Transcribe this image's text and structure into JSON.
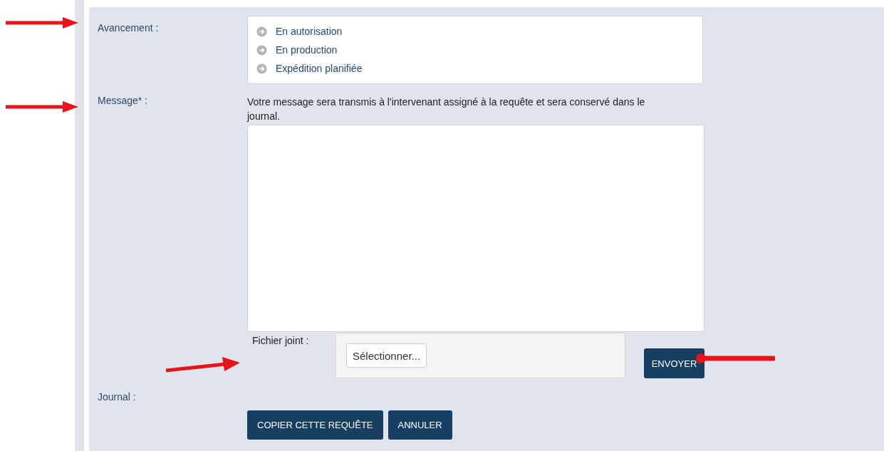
{
  "avancement": {
    "label": "Avancement :",
    "items": [
      {
        "label": "En autorisation"
      },
      {
        "label": "En production"
      },
      {
        "label": "Expédition planifiée"
      }
    ]
  },
  "message": {
    "label": "Message* :",
    "help": "Votre message sera transmis à l'intervenant assigné à la requête et sera conservé dans le journal."
  },
  "attachment": {
    "label": "Fichier joint :",
    "button": "Sélectionner..."
  },
  "send_button": "ENVOYER",
  "journal": {
    "label": "Journal :"
  },
  "buttons": [
    "COPIER CETTE REQUÊTE",
    "ANNULER"
  ]
}
